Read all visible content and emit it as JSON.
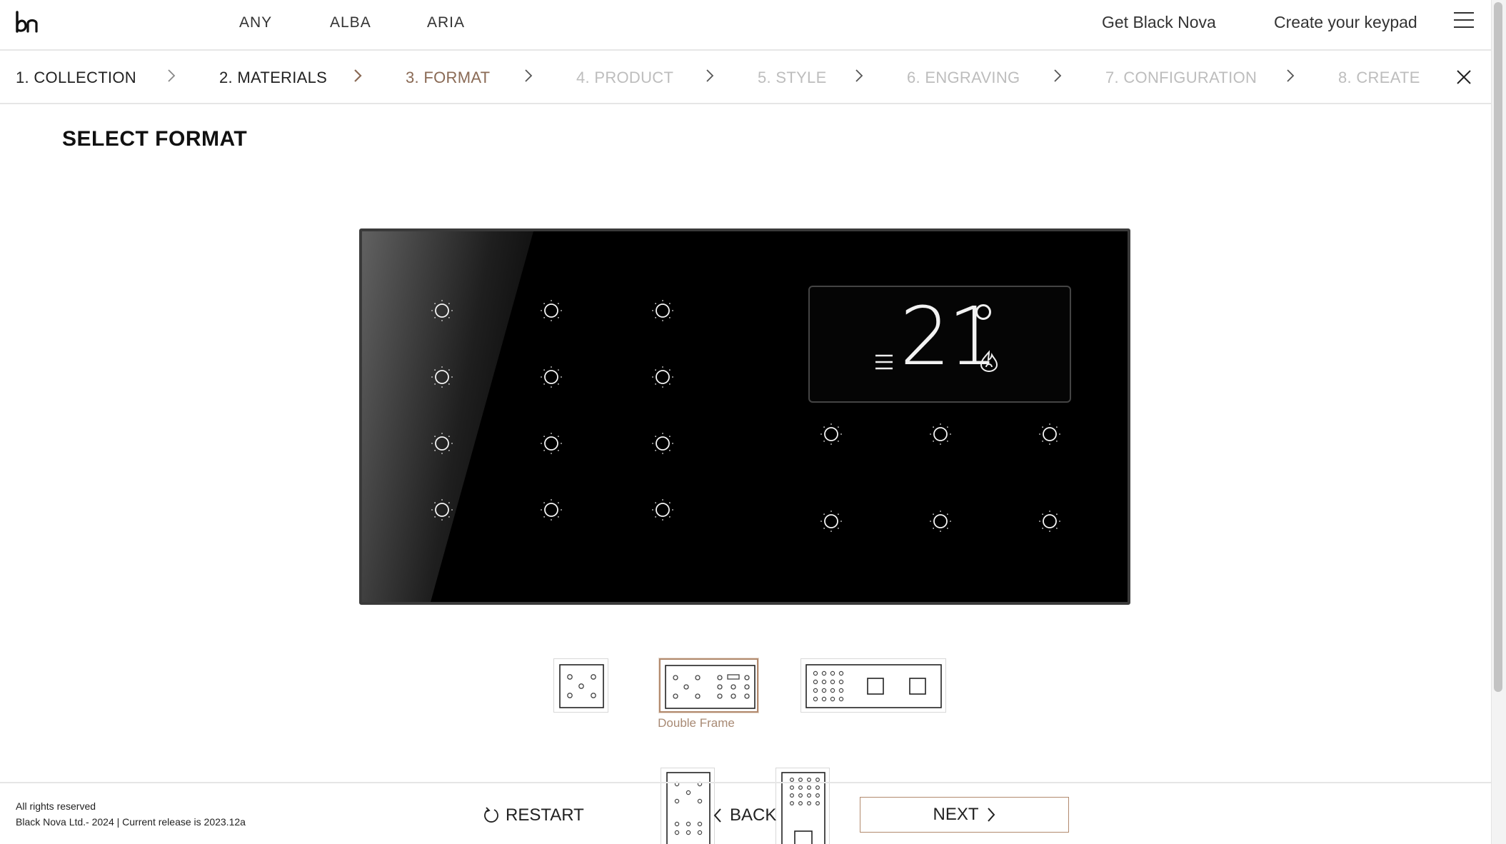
{
  "nav": {
    "links": [
      "ANY",
      "ALBA",
      "ARIA"
    ],
    "get_black_nova": "Get Black Nova",
    "create_keypad": "Create your keypad"
  },
  "steps": [
    {
      "label": "1. COLLECTION",
      "state": "done"
    },
    {
      "label": "2. MATERIALS",
      "state": "done"
    },
    {
      "label": "3. FORMAT",
      "state": "active"
    },
    {
      "label": "4. PRODUCT",
      "state": "todo"
    },
    {
      "label": "5. STYLE",
      "state": "todo"
    },
    {
      "label": "6. ENGRAVING",
      "state": "todo"
    },
    {
      "label": "7. CONFIGURATION",
      "state": "todo"
    },
    {
      "label": "8. CREATE",
      "state": "todo"
    }
  ],
  "main": {
    "title": "SELECT FORMAT",
    "display_temperature": "21",
    "selected_format_label": "Double Frame"
  },
  "footer": {
    "rights": "All rights reserved",
    "release": "Black Nova Ltd.- 2024  |  Current release is 2023.12a",
    "restart": "RESTART",
    "back": "BACK",
    "next": "NEXT"
  },
  "colors": {
    "accent": "#8a6a55",
    "accent_border": "#b28a6e",
    "inactive_step": "#bdbdbd",
    "keypad": "#000000"
  }
}
